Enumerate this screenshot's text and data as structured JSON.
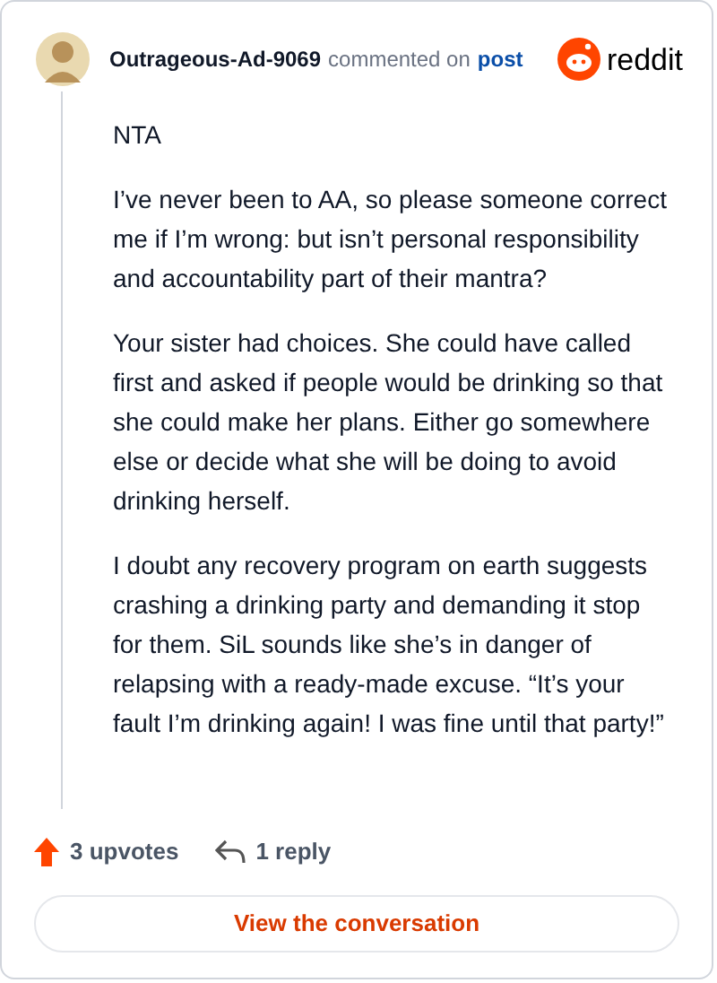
{
  "comment": {
    "author": "Outrageous-Ad-9069",
    "action": "commented on",
    "link": "post",
    "brand": "reddit",
    "paragraphs": [
      "NTA",
      "I’ve never been to AA, so please someone correct me if I’m wrong: but isn’t personal responsibility and accountability part of their mantra?",
      "Your sister had choices. She could have called first and asked if people would be drinking so that she could make her plans. Either go somewhere else or decide what she will be doing to avoid drinking herself.",
      "I doubt any recovery program on earth suggests crashing a drinking party and demanding it stop for them. SiL sounds like she’s in danger of relapsing with a ready-made excuse. “It’s your fault I’m drinking again! I was fine until that party!”"
    ]
  },
  "footer": {
    "upvotes": "3 upvotes",
    "replies": "1 reply",
    "button": "View the conversation"
  }
}
